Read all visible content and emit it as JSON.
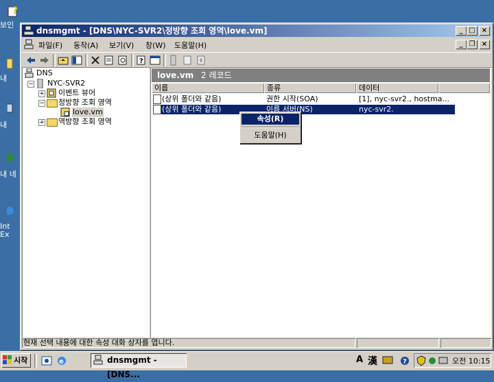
{
  "desktop": {
    "icons": [
      {
        "label": "보인",
        "icon": "help-file-icon"
      },
      {
        "label": "내",
        "icon": "folder-icon"
      },
      {
        "label": "내 ",
        "icon": "computer-icon"
      },
      {
        "label": "내 네",
        "icon": "network-icon"
      },
      {
        "label": "Int",
        "icon": "internet-explorer-icon"
      },
      {
        "label": "Ex",
        "icon": "internet-explorer-icon"
      }
    ]
  },
  "window": {
    "title": "dnsmgmt - [DNS\\NYC-SVR2\\정방향 조회 영역\\love.vm]",
    "controls": {
      "minimize": "_",
      "maximize": "□",
      "close": "×"
    }
  },
  "menu": {
    "items": [
      "파일(F)",
      "동작(A)",
      "보기(V)",
      "창(W)",
      "도움말(H)"
    ],
    "inner_controls": {
      "minimize": "_",
      "restore": "❐",
      "close": "×"
    }
  },
  "toolbar": {
    "icons": [
      "back-arrow-icon",
      "forward-arrow-icon",
      "up-folder-icon",
      "show-hide-tree-icon",
      "delete-icon",
      "properties-icon",
      "refresh-icon",
      "help-icon",
      "new-window-icon",
      "server-icon",
      "zone-icon",
      "record-icon"
    ]
  },
  "tree": {
    "root": "DNS",
    "server": "NYC-SVR2",
    "event_viewer": "이벤트 뷰어",
    "forward_zones": "정방향 조회 영역",
    "zone": "love.vm",
    "reverse_zones": "역방향 조회 영역"
  },
  "details": {
    "zone_name": "love.vm",
    "record_count": "2 레코드",
    "columns": [
      "이름",
      "종류",
      "데이터"
    ],
    "rows": [
      {
        "name": "(상위 폴더와 같음)",
        "type": "권한 시작(SOA)",
        "data": "[1], nyc-svr2., hostma..."
      },
      {
        "name": "(상위 폴더와 같음)",
        "type": "이름 서버(NS)",
        "data": "nyc-svr2."
      }
    ]
  },
  "context_menu": {
    "properties": "속성(R)",
    "help": "도움말(H)"
  },
  "status_bar": {
    "message": "현재 선택 내용에 대한 속성 대화 상자를 엽니다."
  },
  "taskbar": {
    "start": "시작",
    "task": "dnsmgmt - [DNS...",
    "ime_a": "A",
    "ime_han": "漢",
    "clock": "오전 10:15"
  },
  "colors": {
    "desktop": "#3a6ea5",
    "titlebar_start": "#0a246a",
    "titlebar_end": "#a6caf0",
    "selection": "#0a246a",
    "face": "#d4d0c8"
  }
}
